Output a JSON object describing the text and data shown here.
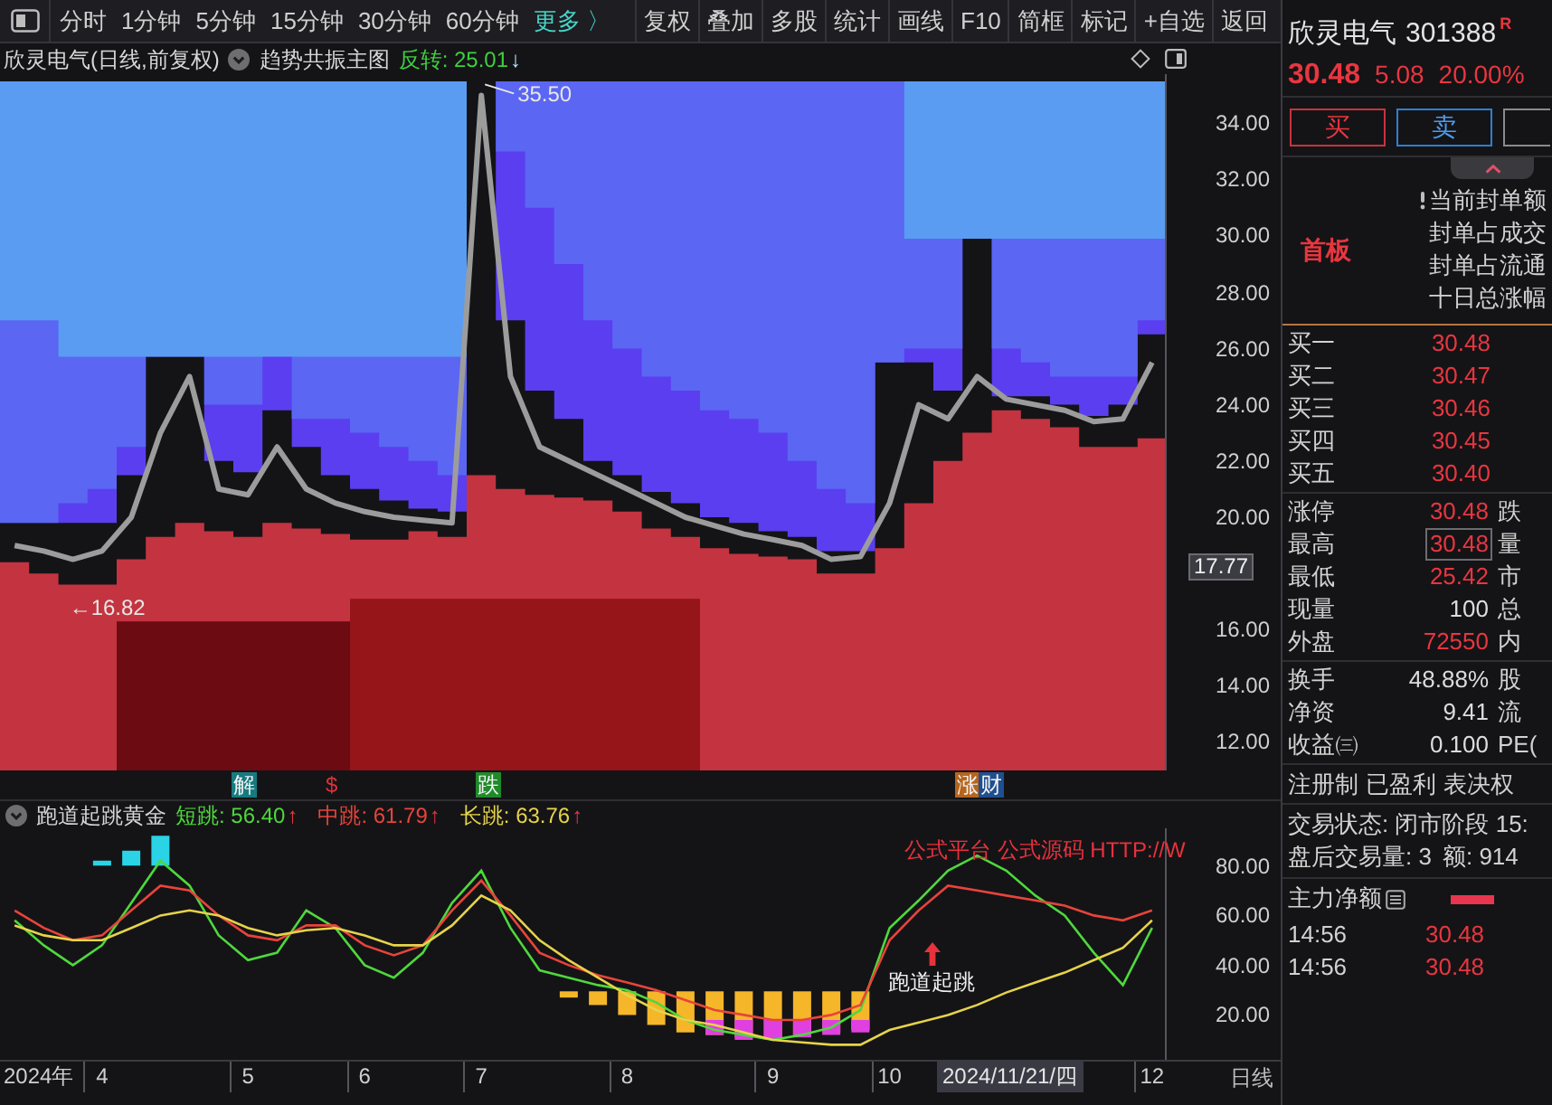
{
  "toolbar": {
    "periods": [
      {
        "label": "分时",
        "selected": false
      },
      {
        "label": "1分钟",
        "selected": false
      },
      {
        "label": "5分钟",
        "selected": false
      },
      {
        "label": "15分钟",
        "selected": false
      },
      {
        "label": "30分钟",
        "selected": false
      },
      {
        "label": "60分钟",
        "selected": false
      },
      {
        "label": "更多 〉",
        "selected": true
      }
    ],
    "tools": [
      "复权",
      "叠加",
      "多股",
      "统计",
      "画线",
      "F10",
      "简框",
      "标记",
      "+自选",
      "返回"
    ]
  },
  "main_chart": {
    "title": "欣灵电气(日线,前复权)",
    "indicator": "趋势共振主图",
    "signal": {
      "label": "反转: 25.01",
      "arrow": "↓"
    },
    "high_label": "35.50",
    "low_label": "←16.82",
    "price_tag": "17.77",
    "chart_data": {
      "type": "line",
      "ylim": [
        11,
        35.75
      ],
      "yticks": [
        {
          "value": 34,
          "label": "34.00"
        },
        {
          "value": 32,
          "label": "32.00"
        },
        {
          "value": 30,
          "label": "30.00"
        },
        {
          "value": 28,
          "label": "28.00"
        },
        {
          "value": 26,
          "label": "26.00"
        },
        {
          "value": 24,
          "label": "24.00"
        },
        {
          "value": 22,
          "label": "22.00"
        },
        {
          "value": 20,
          "label": "20.00"
        },
        {
          "value": 16,
          "label": "16.00"
        },
        {
          "value": 14,
          "label": "14.00"
        },
        {
          "value": 12,
          "label": "12.00"
        }
      ],
      "series": [
        {
          "color": "#9c9c9c",
          "values": [
            19,
            18.8,
            18.5,
            18.8,
            20,
            23,
            25,
            21,
            20.8,
            22.5,
            21,
            20.5,
            20.2,
            20,
            19.9,
            19.8,
            35,
            25,
            22.5,
            22,
            21.5,
            21,
            20.5,
            20,
            19.7,
            19.4,
            19.2,
            19,
            18.5,
            18.6,
            20.5,
            24,
            23.5,
            25,
            24.2,
            24,
            23.8,
            23.4,
            23.5,
            25.5
          ]
        }
      ]
    },
    "signals": [
      {
        "text": "解",
        "kind": "tag",
        "color": "#167a80"
      },
      {
        "text": "$",
        "kind": "mark",
        "color": "#e0303a"
      },
      {
        "text": "跌",
        "kind": "tag",
        "color": "#1f8a2a"
      },
      {
        "text": "涨",
        "kind": "tag",
        "color": "#b5651d"
      },
      {
        "text": "财",
        "kind": "tag",
        "color": "#1f4f8f"
      }
    ]
  },
  "indicator": {
    "name": "跑道起跳黄金",
    "legend": [
      {
        "label": "短跳: 56.40",
        "color": "#4fd83c",
        "arrow": "↑"
      },
      {
        "label": "中跳: 61.79",
        "color": "#e8443a",
        "arrow": "↑"
      },
      {
        "label": "长跳: 63.76",
        "color": "#e6d34a",
        "arrow": "↑"
      }
    ],
    "signal_label": "跑道起跳",
    "note": "公式平台 公式源码 HTTP://W",
    "year_label": "2024年",
    "cursor_date": "2024/11/21/四",
    "period_label": "日线",
    "chart_data": {
      "type": "line",
      "categories": [
        null,
        null,
        null,
        "4",
        null,
        null,
        null,
        null,
        "5",
        null,
        null,
        null,
        "6",
        null,
        null,
        null,
        "7",
        null,
        null,
        null,
        null,
        "8",
        null,
        null,
        null,
        null,
        "9",
        null,
        null,
        null,
        "10",
        null,
        null,
        null,
        null,
        null,
        null,
        null,
        null,
        "12"
      ],
      "ylim": [
        2,
        95
      ],
      "yticks": [
        {
          "value": 80,
          "label": "80.00"
        },
        {
          "value": 60,
          "label": "60.00"
        },
        {
          "value": 40,
          "label": "40.00"
        },
        {
          "value": 20,
          "label": "20.00"
        }
      ],
      "series": [
        {
          "color": "#4fd83c",
          "values": [
            58,
            48,
            40,
            48,
            65,
            82,
            72,
            52,
            42,
            45,
            62,
            55,
            40,
            35,
            45,
            65,
            78,
            55,
            38,
            35,
            32,
            30,
            25,
            18,
            14,
            12,
            10,
            12,
            15,
            22,
            55,
            66,
            78,
            84,
            78,
            68,
            60,
            45,
            32,
            55
          ]
        },
        {
          "color": "#e8443a",
          "values": [
            62,
            55,
            50,
            52,
            62,
            72,
            70,
            60,
            52,
            50,
            56,
            56,
            48,
            44,
            48,
            62,
            74,
            60,
            45,
            40,
            36,
            33,
            30,
            26,
            22,
            20,
            18,
            18,
            20,
            24,
            50,
            62,
            72,
            70,
            68,
            66,
            64,
            60,
            58,
            62
          ]
        },
        {
          "color": "#e6d34a",
          "values": [
            56,
            52,
            50,
            50,
            55,
            60,
            62,
            60,
            55,
            52,
            54,
            55,
            52,
            48,
            48,
            56,
            68,
            62,
            50,
            42,
            35,
            28,
            22,
            18,
            16,
            13,
            10,
            9,
            8,
            8,
            14,
            17,
            20,
            24,
            29,
            33,
            37,
            42,
            47,
            58
          ]
        }
      ]
    }
  },
  "quote": {
    "name": "欣灵电气",
    "code": "301388",
    "badge": "R",
    "price": "30.48",
    "change": "5.08",
    "change_pct": "20.00%"
  },
  "trade_buttons": [
    {
      "label": "买",
      "kind": "buy"
    },
    {
      "label": "卖",
      "kind": "sell"
    },
    {
      "kind": "more"
    }
  ],
  "seal": {
    "tag": "首板",
    "lines": [
      "当前封单额",
      "封单占成交",
      "封单占流通",
      "十日总涨幅"
    ]
  },
  "bids": [
    {
      "label": "买一",
      "price": "30.48"
    },
    {
      "label": "买二",
      "price": "30.47"
    },
    {
      "label": "买三",
      "price": "30.46"
    },
    {
      "label": "买四",
      "price": "30.45"
    },
    {
      "label": "买五",
      "price": "30.40"
    }
  ],
  "stats": [
    {
      "label": "涨停",
      "value": "30.48",
      "color": "#e8363f",
      "boxed": false,
      "extra": "跌"
    },
    {
      "label": "最高",
      "value": "30.48",
      "color": "#e8363f",
      "boxed": true,
      "extra": "量"
    },
    {
      "label": "最低",
      "value": "25.42",
      "color": "#e8363f",
      "boxed": false,
      "extra": "市"
    },
    {
      "label": "现量",
      "value": "100",
      "color": "#dcdcdc",
      "boxed": false,
      "extra": "总"
    },
    {
      "label": "外盘",
      "value": "72550",
      "color": "#e8363f",
      "boxed": false,
      "extra": "内"
    }
  ],
  "fundamentals": [
    {
      "label": "换手",
      "value": "48.88%",
      "extra": "股"
    },
    {
      "label": "净资",
      "value": "9.41",
      "extra": "流"
    },
    {
      "label": "收益㈢",
      "value": "0.100",
      "extra": "PE("
    }
  ],
  "tags": [
    "注册制",
    "已盈利",
    "表决权"
  ],
  "trade_status": {
    "phase": "交易状态: 闭市阶段 15:",
    "after_hours_volume": "盘后交易量: 3",
    "after_hours_amount": "额: 914"
  },
  "main_flow": {
    "label": "主力净额"
  },
  "ticks": [
    {
      "time": "14:56",
      "price": "30.48"
    },
    {
      "time": "14:56",
      "price": "30.48"
    }
  ]
}
